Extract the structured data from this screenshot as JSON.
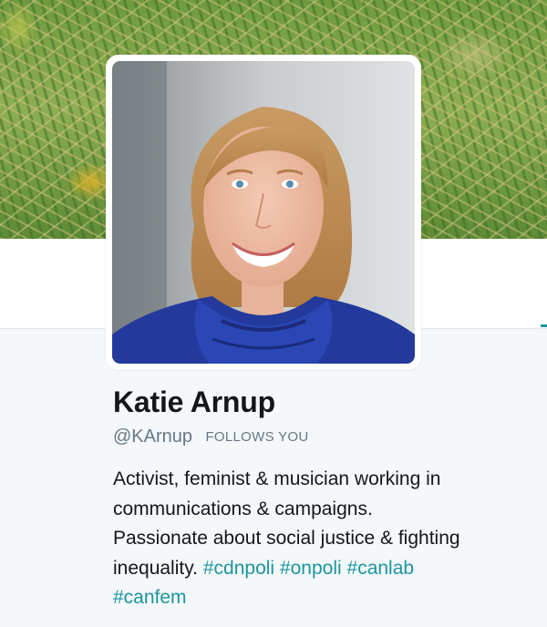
{
  "profile": {
    "name": "Katie Arnup",
    "handle": "@KArnup",
    "follows_badge": "FOLLOWS YOU",
    "bio_lines": [
      "Activist, feminist & musician working in",
      "communications & campaigns.",
      "Passionate about social justice & fighting",
      "inequality."
    ],
    "hashtags": [
      "#cdnpoli",
      "#onpoli",
      "#canlab",
      "#canfem"
    ]
  },
  "colors": {
    "link": "#1b95a0",
    "text": "#14171a",
    "muted": "#657786",
    "page_bg": "#f5f8fa"
  }
}
